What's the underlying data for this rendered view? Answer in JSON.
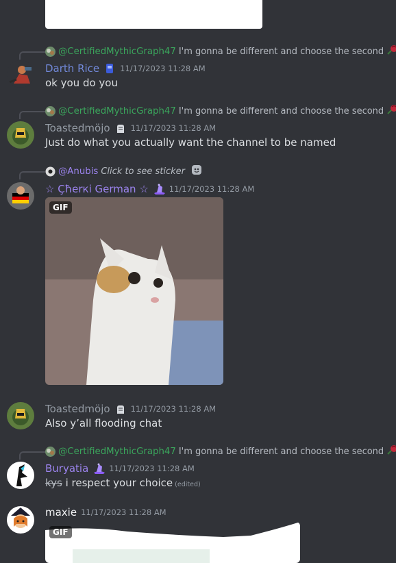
{
  "colors": {
    "background": "#313338",
    "mention": "#3ba55c",
    "timestamp": "#949ba4",
    "text": "#dbdee1",
    "username_purple": "#9c84ef",
    "username_gray": "#949ba4",
    "username_blue": "#7289da",
    "username_maxie": "#f2f3f5"
  },
  "messages": [
    {
      "reply": {
        "mention": "@CertifiedMythicGraph47",
        "text": "I'm gonna be different and choose the second",
        "icon": "red-rose-emoji-icon"
      },
      "username": "Darth Rice",
      "badge": "blue-gem-badge-icon",
      "timestamp": "11/17/2023 11:28 AM",
      "content": "ok you do you"
    },
    {
      "reply": {
        "mention": "@CertifiedMythicGraph47",
        "text": "I'm gonna be different and choose the second",
        "icon": "red-rose-emoji-icon"
      },
      "username": "Toastedmöjo",
      "badge": "hand-badge-icon",
      "timestamp": "11/17/2023 11:28 AM",
      "content": "Just do what you actually want the channel to be named"
    },
    {
      "reply": {
        "mention": "@Anubis",
        "text": "Click to see sticker",
        "icon": "sticker-icon"
      },
      "username": "☆ Çħerкi German ☆",
      "badge": "purple-hat-badge-icon",
      "timestamp": "11/17/2023 11:28 AM",
      "gif_label": "GIF"
    },
    {
      "username": "Toastedmöjo",
      "badge": "hand-badge-icon",
      "timestamp": "11/17/2023 11:28 AM",
      "content": "Also y’all flooding chat"
    },
    {
      "reply": {
        "mention": "@CertifiedMythicGraph47",
        "text": "I'm gonna be different and choose the second",
        "icon": "red-rose-emoji-icon"
      },
      "username": "Buryatia",
      "badge": "purple-hat-badge-icon",
      "timestamp": "11/17/2023 11:28 AM",
      "content_strike": "kys",
      "content": " i respect your choice",
      "edited": "(edited)"
    },
    {
      "username": "maxie",
      "timestamp": "11/17/2023 11:28 AM",
      "gif_label": "GIF"
    }
  ]
}
